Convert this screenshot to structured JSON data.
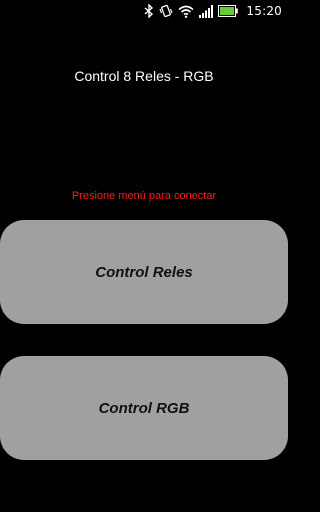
{
  "status_bar": {
    "time": "15:20",
    "icons": [
      "bluetooth-icon",
      "vibrate-icon",
      "wifi-icon",
      "signal-icon",
      "battery-icon"
    ]
  },
  "app": {
    "title": "Control 8 Reles - RGB",
    "hint": "Presione menú para conectar",
    "buttons": {
      "reles_label": "Control Reles",
      "rgb_label": "Control RGB"
    }
  },
  "colors": {
    "background": "#000000",
    "hint_text": "#ff1a1a",
    "button_bg": "#a0a0a0",
    "button_text": "#111111",
    "battery_fill": "#66cc33"
  }
}
